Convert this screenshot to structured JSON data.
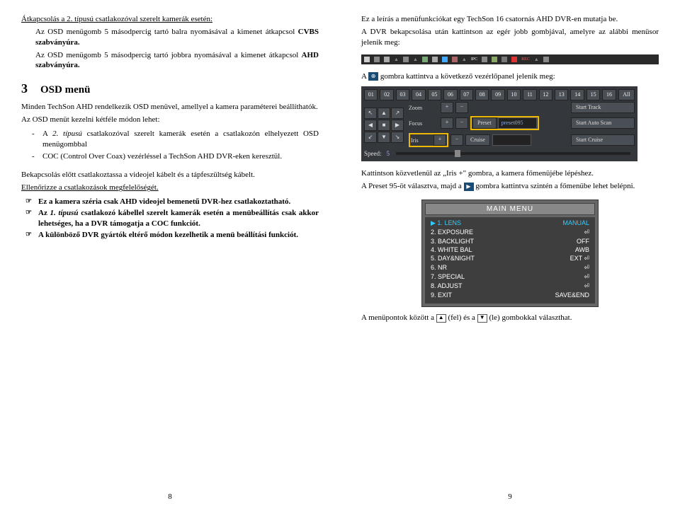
{
  "left": {
    "p1": "Átkapcsolás a 2. típusú csatlakozóval szerelt kamerák esetén:",
    "p2a": "Az OSD menügomb 5 másodpercig tartó balra nyomásával a kimenet átkapcsol ",
    "p2b": "CVBS szabványúra.",
    "p3a": "Az OSD menügomb 5 másodpercig tartó jobbra nyomásával a kimenet átkapcsol ",
    "p3b": "AHD szabványúra.",
    "sec_num": "3",
    "sec_title": "OSD menü",
    "p4": "Minden TechSon AHD rendelkezik OSD menüvel, amellyel a kamera paraméterei beállíthatók.",
    "p5": "Az OSD menüt kezelni kétféle módon lehet:",
    "li1a": "A ",
    "li1b": "2. típusú",
    "li1c": " csatlakozóval szerelt kamerák esetén a csatlakozón elhelyezett OSD menügombbal",
    "li2": "COC (Control Over Coax) vezérléssel a TechSon AHD DVR-eken keresztül.",
    "p6": "Bekapcsolás előtt csatlakoztassa a videojel kábelt és a tápfeszültség kábelt.",
    "p7": "Ellenőrizze a csatlakozások megfelelőségét.",
    "b1": "Ez a kamera széria csak AHD videojel bemenetű DVR-hez csatlakoztatható.",
    "b2a": "Az ",
    "b2b": "1. típusú",
    "b2c": " csatlakozó kábellel szerelt kamerák esetén a menübeállítás csak akkor lehetséges, ha a DVR támogatja a COC funkciót.",
    "b3": "A különböző DVR gyártók eltérő módon kezelhetik a menü beállítási funkciót.",
    "pagenum": "8"
  },
  "right": {
    "p1": "Ez a leírás a menüfunkciókat egy TechSon 16 csatornás AHD DVR-en mutatja be.",
    "p2": "A DVR bekapcsolása után kattintson az egér jobb gombjával, amelyre az alábbi menüsor jelenik meg:",
    "toolbar": {
      "ipc": "IPC",
      "rec": "REC"
    },
    "p3a": "A ",
    "p3b": " gombra kattintva a következő vezérlőpanel jelenik meg:",
    "ptz": {
      "nums": [
        "01",
        "02",
        "03",
        "04",
        "05",
        "06",
        "07",
        "08",
        "09",
        "10",
        "11",
        "12",
        "13",
        "14",
        "15",
        "16",
        "All"
      ],
      "zoom": "Zoom",
      "focus": "Focus",
      "iris": "Iris",
      "preset": "Preset",
      "preset_val": "preset095",
      "cruise": "Cruise",
      "start_track": "Start Track",
      "start_auto": "Start Auto Scan",
      "start_cruise": "Start Cruise",
      "speed": "Speed:",
      "speed_val": "5"
    },
    "p4": "Kattintson közvetlenül az „Iris +\" gombra, a kamera főmenüjébe lépéshez.",
    "p5a": "A Preset 95-öt választva, majd a ",
    "p5b": " gombra kattintva szintén a főmenübe lehet belépni.",
    "menu": {
      "title": "MAIN MENU",
      "items": [
        {
          "n": "1.",
          "label": "LENS",
          "val": "MANUAL",
          "hl": true
        },
        {
          "n": "2.",
          "label": "EXPOSURE",
          "val": "⏎"
        },
        {
          "n": "3.",
          "label": "BACKLIGHT",
          "val": "OFF"
        },
        {
          "n": "4.",
          "label": "WHITE BAL",
          "val": "AWB"
        },
        {
          "n": "5.",
          "label": "DAY&NIGHT",
          "val": "EXT   ⏎"
        },
        {
          "n": "6.",
          "label": "NR",
          "val": "⏎"
        },
        {
          "n": "7.",
          "label": "SPECIAL",
          "val": "⏎"
        },
        {
          "n": "8.",
          "label": "ADJUST",
          "val": "⏎"
        },
        {
          "n": "9.",
          "label": "EXIT",
          "val": "SAVE&END"
        }
      ]
    },
    "p6a": "A menüpontok között a ",
    "p6b": " (fel) és a ",
    "p6c": " (le) gombokkal választhat.",
    "pagenum": "9"
  }
}
